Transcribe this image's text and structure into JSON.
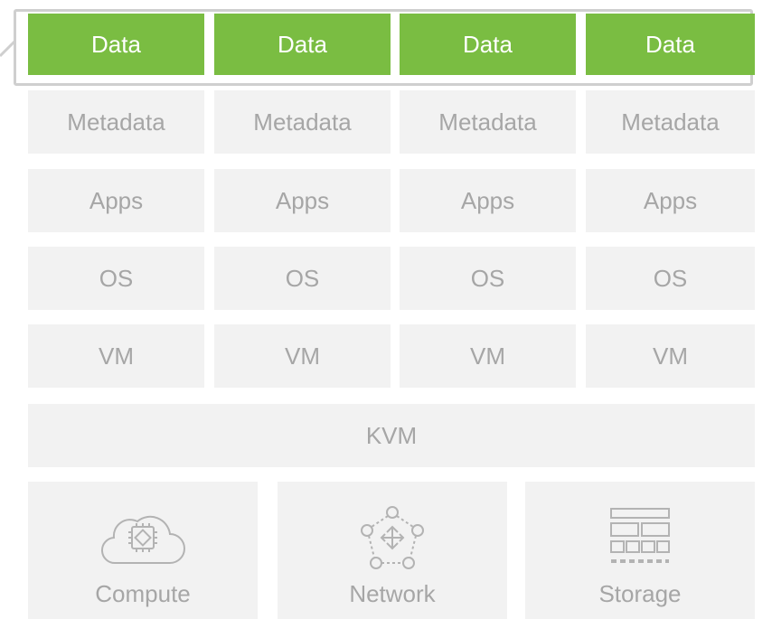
{
  "vm_stacks": [
    {
      "data": "Data",
      "metadata": "Metadata",
      "apps": "Apps",
      "os": "OS",
      "vm": "VM"
    },
    {
      "data": "Data",
      "metadata": "Metadata",
      "apps": "Apps",
      "os": "OS",
      "vm": "VM"
    },
    {
      "data": "Data",
      "metadata": "Metadata",
      "apps": "Apps",
      "os": "OS",
      "vm": "VM"
    },
    {
      "data": "Data",
      "metadata": "Metadata",
      "apps": "Apps",
      "os": "OS",
      "vm": "VM"
    }
  ],
  "hypervisor": "KVM",
  "resources": [
    {
      "label": "Compute",
      "icon": "cloud-chip-icon"
    },
    {
      "label": "Network",
      "icon": "network-nodes-icon"
    },
    {
      "label": "Storage",
      "icon": "storage-grid-icon"
    }
  ],
  "colors": {
    "data": "#7abd42",
    "layer": "#f2f2f2",
    "layer_text": "#a6a6a6",
    "frame": "#cfcfcf"
  }
}
